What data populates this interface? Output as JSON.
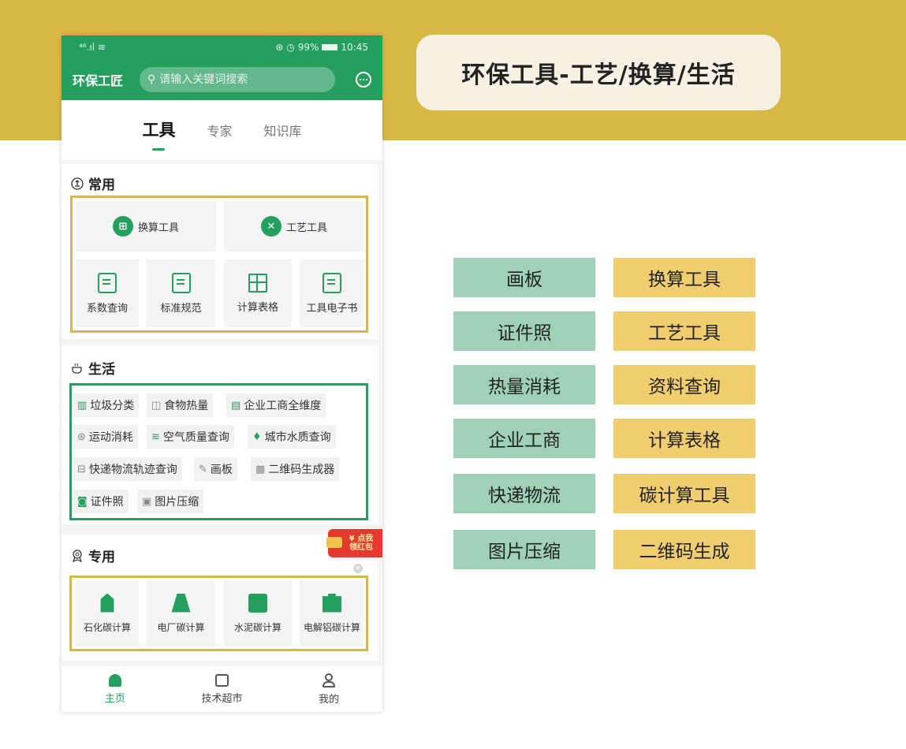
{
  "banner": {
    "title": "环保工具-工艺/换算/生活"
  },
  "status": {
    "signal": "⁴⁶.ıl",
    "wifi": "≋",
    "right_icons": "⊛ ◷",
    "battery": "99%",
    "time": "10:45"
  },
  "app": {
    "title": "环保工匠",
    "search_placeholder": "请输入关键词搜索"
  },
  "tabs": [
    "工具",
    "专家",
    "知识库"
  ],
  "common": {
    "title": "常用",
    "wide": [
      "换算工具",
      "工艺工具"
    ],
    "tiles": [
      "系数查询",
      "标准规范",
      "计算表格",
      "工具电子书"
    ]
  },
  "life": {
    "title": "生活",
    "chips": [
      {
        "label": "垃圾分类",
        "icon": "trash-icon"
      },
      {
        "label": "食物热量",
        "icon": "food-icon"
      },
      {
        "label": "企业工商全维度",
        "icon": "building-icon"
      },
      {
        "label": "运动消耗",
        "icon": "ball-icon"
      },
      {
        "label": "空气质量查询",
        "icon": "air-icon"
      },
      {
        "label": "城市水质查询",
        "icon": "water-icon"
      },
      {
        "label": "快递物流轨迹查询",
        "icon": "truck-icon"
      },
      {
        "label": "画板",
        "icon": "pen-icon"
      },
      {
        "label": "二维码生成器",
        "icon": "qr-icon"
      },
      {
        "label": "证件照",
        "icon": "camera-icon"
      },
      {
        "label": "图片压缩",
        "icon": "image-icon"
      }
    ]
  },
  "special": {
    "title": "专用",
    "tiles": [
      "石化碳计算",
      "电厂碳计算",
      "水泥碳计算",
      "电解铝碳计算"
    ]
  },
  "redpack": {
    "line1": "¥ 点我",
    "line2": "领红包"
  },
  "nav": [
    "主页",
    "技术超市",
    "我的"
  ],
  "features": {
    "green": [
      "画板",
      "证件照",
      "热量消耗",
      "企业工商",
      "快递物流",
      "图片压缩"
    ],
    "gold": [
      "换算工具",
      "工艺工具",
      "资料查询",
      "计算表格",
      "碳计算工具",
      "二维码生成"
    ]
  },
  "colors": {
    "brand_green": "#249f5e",
    "gold": "#d9b945",
    "tag_green": "#9ed1b5",
    "tag_gold": "#f0cd6f"
  }
}
